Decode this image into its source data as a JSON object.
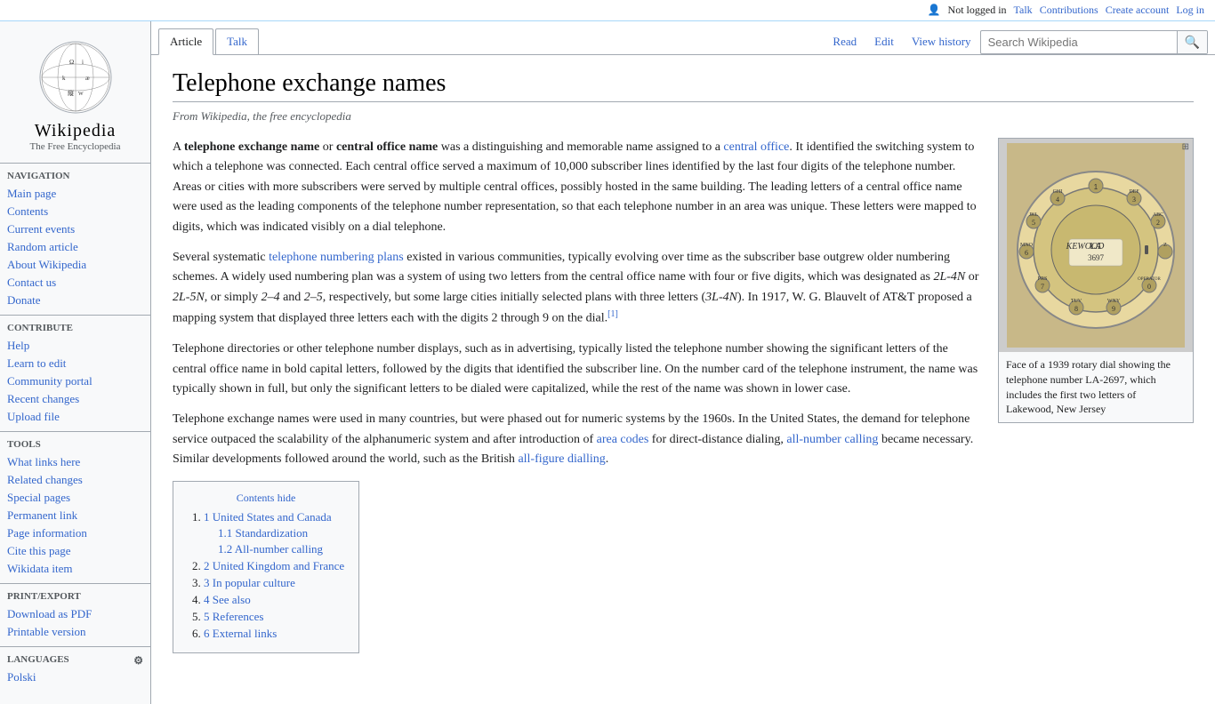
{
  "topbar": {
    "not_logged_in": "Not logged in",
    "talk": "Talk",
    "contributions": "Contributions",
    "create_account": "Create account",
    "log_in": "Log in"
  },
  "logo": {
    "title": "Wikipedia",
    "subtitle": "The Free Encyclopedia"
  },
  "sidebar": {
    "navigation_heading": "Navigation",
    "items_navigation": [
      {
        "label": "Main page",
        "id": "main-page"
      },
      {
        "label": "Contents",
        "id": "contents"
      },
      {
        "label": "Current events",
        "id": "current-events"
      },
      {
        "label": "Random article",
        "id": "random-article"
      },
      {
        "label": "About Wikipedia",
        "id": "about-wikipedia"
      },
      {
        "label": "Contact us",
        "id": "contact-us"
      },
      {
        "label": "Donate",
        "id": "donate"
      }
    ],
    "contribute_heading": "Contribute",
    "items_contribute": [
      {
        "label": "Help",
        "id": "help"
      },
      {
        "label": "Learn to edit",
        "id": "learn-to-edit"
      },
      {
        "label": "Community portal",
        "id": "community-portal"
      },
      {
        "label": "Recent changes",
        "id": "recent-changes"
      },
      {
        "label": "Upload file",
        "id": "upload-file"
      }
    ],
    "tools_heading": "Tools",
    "items_tools": [
      {
        "label": "What links here",
        "id": "what-links-here"
      },
      {
        "label": "Related changes",
        "id": "related-changes"
      },
      {
        "label": "Special pages",
        "id": "special-pages"
      },
      {
        "label": "Permanent link",
        "id": "permanent-link"
      },
      {
        "label": "Page information",
        "id": "page-information"
      },
      {
        "label": "Cite this page",
        "id": "cite-this-page"
      },
      {
        "label": "Wikidata item",
        "id": "wikidata-item"
      }
    ],
    "print_heading": "Print/export",
    "items_print": [
      {
        "label": "Download as PDF",
        "id": "download-pdf"
      },
      {
        "label": "Printable version",
        "id": "printable-version"
      }
    ],
    "languages_heading": "Languages",
    "items_languages": [
      {
        "label": "Polski",
        "id": "polski"
      }
    ]
  },
  "tabs": {
    "article": "Article",
    "talk": "Talk",
    "read": "Read",
    "edit": "Edit",
    "view_history": "View history"
  },
  "search": {
    "placeholder": "Search Wikipedia"
  },
  "page": {
    "title": "Telephone exchange names",
    "from": "From Wikipedia, the free encyclopedia",
    "intro_paragraph": "A telephone exchange name or central office name was a distinguishing and memorable name assigned to a central office. It identified the switching system to which a telephone was connected. Each central office served a maximum of 10,000 subscriber lines identified by the last four digits of the telephone number. Areas or cities with more subscribers were served by multiple central offices, possibly hosted in the same building. The leading letters of a central office name were used as the leading components of the telephone number representation, so that each telephone number in an area was unique. These letters were mapped to digits, which was indicated visibly on a dial telephone.",
    "para2": "Several systematic telephone numbering plans existed in various communities, typically evolving over time as the subscriber base outgrew older numbering schemes. A widely used numbering plan was a system of using two letters from the central office name with four or five digits, which was designated as 2L-4N or 2L-5N, or simply 2–4 and 2–5, respectively, but some large cities initially selected plans with three letters (3L-4N). In 1917, W. G. Blauvelt of AT&T proposed a mapping system that displayed three letters each with the digits 2 through 9 on the dial.",
    "para3": "Telephone directories or other telephone number displays, such as in advertising, typically listed the telephone number showing the significant letters of the central office name in bold capital letters, followed by the digits that identified the subscriber line. On the number card of the telephone instrument, the name was typically shown in full, but only the significant letters to be dialed were capitalized, while the rest of the name was shown in lower case.",
    "para4": "Telephone exchange names were used in many countries, but were phased out for numeric systems by the 1960s. In the United States, the demand for telephone service outpaced the scalability of the alphanumeric system and after introduction of area codes for direct-distance dialing, all-number calling became necessary. Similar developments followed around the world, such as the British all-figure dialling.",
    "image_caption": "Face of a 1939 rotary dial showing the telephone number LA-2697, which includes the first two letters of Lakewood, New Jersey",
    "footnote1": "[1]"
  },
  "toc": {
    "title": "Contents",
    "hide_label": "hide",
    "items": [
      {
        "num": "1",
        "label": "United States and Canada",
        "sub": [
          {
            "num": "1.1",
            "label": "Standardization"
          },
          {
            "num": "1.2",
            "label": "All-number calling"
          }
        ]
      },
      {
        "num": "2",
        "label": "United Kingdom and France"
      },
      {
        "num": "3",
        "label": "In popular culture"
      },
      {
        "num": "4",
        "label": "See also"
      },
      {
        "num": "5",
        "label": "References"
      },
      {
        "num": "6",
        "label": "External links"
      }
    ]
  }
}
